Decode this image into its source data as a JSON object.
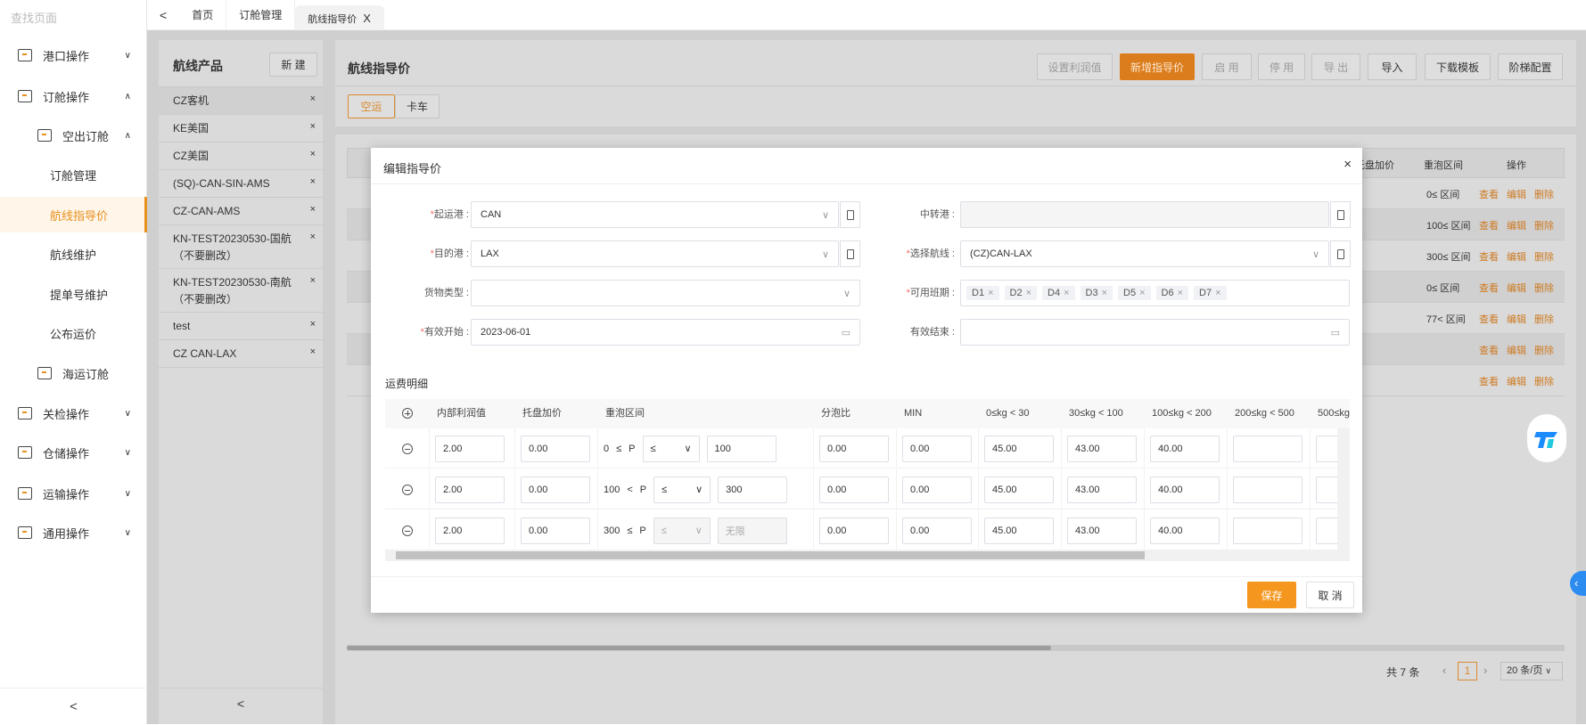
{
  "sidebar": {
    "search_placeholder": "查找页面",
    "items": [
      {
        "label": "港口操作",
        "level": 1,
        "chevron": "down"
      },
      {
        "label": "订舱操作",
        "level": 1,
        "chevron": "up"
      },
      {
        "label": "空出订舱",
        "level": 2,
        "chevron": "up"
      },
      {
        "label": "订舱管理",
        "level": 3
      },
      {
        "label": "航线指导价",
        "level": 3,
        "active": true
      },
      {
        "label": "航线维护",
        "level": 3
      },
      {
        "label": "提单号维护",
        "level": 3
      },
      {
        "label": "公布运价",
        "level": 3
      },
      {
        "label": "海运订舱",
        "level": 2
      },
      {
        "label": "关检操作",
        "level": 1,
        "chevron": "down"
      },
      {
        "label": "仓储操作",
        "level": 1,
        "chevron": "down"
      },
      {
        "label": "运输操作",
        "level": 1,
        "chevron": "down"
      },
      {
        "label": "通用操作",
        "level": 1,
        "chevron": "down"
      }
    ],
    "collapse": "<"
  },
  "tabs": {
    "back": "<",
    "items": [
      "首页",
      "订舱管理",
      "航线指导价"
    ],
    "active_close": "X"
  },
  "products": {
    "title": "航线产品",
    "new_label": "新 建",
    "items": [
      "CZ客机",
      "KE美国",
      "CZ美国",
      "(SQ)-CAN-SIN-AMS",
      "CZ-CAN-AMS",
      "KN-TEST20230530-国航（不要删改）",
      "KN-TEST20230530-南航（不要删改）",
      "test",
      "CZ CAN-LAX"
    ],
    "remove": "×",
    "collapse": "<"
  },
  "main": {
    "title": "航线指导价",
    "toolbar": [
      {
        "label": "设置利润值",
        "state": "disabled"
      },
      {
        "label": "新增指导价",
        "state": "primary"
      },
      {
        "label": "启 用",
        "state": "disabled"
      },
      {
        "label": "停 用",
        "state": "disabled"
      },
      {
        "label": "导 出",
        "state": "disabled"
      },
      {
        "label": "导入"
      },
      {
        "label": "下载模板"
      },
      {
        "label": "阶梯配置"
      }
    ],
    "mode_tabs": [
      "空运",
      "卡车"
    ],
    "table": {
      "headers": [
        "托盘加价",
        "重泡区间",
        "操作"
      ],
      "rows": [
        "0≤ 区间",
        "100≤ 区间",
        "300≤ 区间",
        "0≤ 区间",
        "77< 区间",
        "",
        ""
      ],
      "actions": [
        "查看",
        "编辑",
        "删除"
      ]
    },
    "pagination": {
      "total": "共 7 条",
      "page": "1",
      "page_size": "20 条/页"
    }
  },
  "modal": {
    "title": "编辑指导价",
    "close": "×",
    "fields": {
      "origin": {
        "label": "起运港",
        "value": "CAN"
      },
      "transit": {
        "label": "中转港",
        "value": ""
      },
      "dest": {
        "label": "目的港",
        "value": "LAX"
      },
      "route": {
        "label": "选择航线",
        "value": "(CZ)CAN-LAX"
      },
      "cargo": {
        "label": "货物类型",
        "value": ""
      },
      "schedule": {
        "label": "可用班期",
        "tags": [
          "D1",
          "D2",
          "D4",
          "D3",
          "D5",
          "D6",
          "D7"
        ]
      },
      "start": {
        "label": "有效开始",
        "value": "2023-06-01"
      },
      "end": {
        "label": "有效结束",
        "value": ""
      }
    },
    "section": "运费明细",
    "columns": [
      "内部利润值",
      "托盘加价",
      "重泡区间",
      "分泡比",
      "MIN",
      "0≤kg < 30",
      "30≤kg < 100",
      "100≤kg < 200",
      "200≤kg < 500",
      "500≤kg"
    ],
    "rows": [
      {
        "profit": "2.00",
        "pallet": "0.00",
        "lower": "0",
        "op": "≤",
        "cmp": "≤",
        "upper": "100",
        "ratio": "0.00",
        "min": "0.00",
        "p30": "45.00",
        "p100": "43.00",
        "p200": "40.00",
        "p500": ""
      },
      {
        "profit": "2.00",
        "pallet": "0.00",
        "lower": "100",
        "op": "<",
        "cmp": "≤",
        "upper": "300",
        "ratio": "0.00",
        "min": "0.00",
        "p30": "45.00",
        "p100": "43.00",
        "p200": "40.00",
        "p500": ""
      },
      {
        "profit": "2.00",
        "pallet": "0.00",
        "lower": "300",
        "op": "≤",
        "cmp": "≤",
        "upper": "无限",
        "ratio": "0.00",
        "min": "0.00",
        "p30": "45.00",
        "p100": "43.00",
        "p200": "40.00",
        "p500": "",
        "disabled": true
      }
    ],
    "save": "保存",
    "cancel": "取 消"
  },
  "colors": {
    "accent": "#e8901f",
    "save": "#f5961e",
    "link": "#cd7a22"
  }
}
